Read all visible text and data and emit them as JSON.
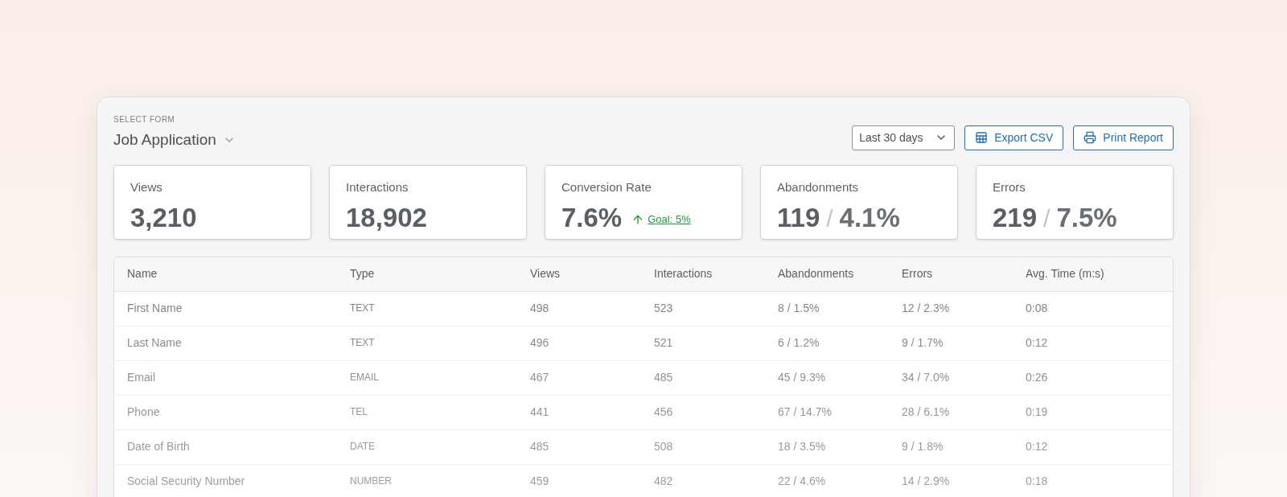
{
  "form_selector": {
    "label": "SELECT FORM",
    "value": "Job Application"
  },
  "date_range": {
    "value": "Last 30 days"
  },
  "buttons": [
    {
      "kind": "export",
      "label": "Export CSV"
    },
    {
      "kind": "print",
      "label": "Print Report"
    }
  ],
  "metrics": [
    {
      "label": "Views",
      "value": "3,210"
    },
    {
      "label": "Interactions",
      "value": "18,902"
    },
    {
      "label": "Conversion Rate",
      "value": "7.6%",
      "goal": "Goal: 5%"
    },
    {
      "label": "Abandonments",
      "value": "119",
      "separator": "/",
      "secondary": "4.1%"
    },
    {
      "label": "Errors",
      "value": "219",
      "separator": "/",
      "secondary": "7.5%"
    }
  ],
  "table": {
    "columns": [
      "Name",
      "Type",
      "Views",
      "Interactions",
      "Abandonments",
      "Errors",
      "Avg. Time (m:s)"
    ],
    "rows": [
      [
        "First Name",
        "TEXT",
        "498",
        "523",
        "8 / 1.5%",
        "12 / 2.3%",
        "0:08"
      ],
      [
        "Last Name",
        "TEXT",
        "496",
        "521",
        "6 / 1.2%",
        "9 / 1.7%",
        "0:12"
      ],
      [
        "Email",
        "EMAIL",
        "467",
        "485",
        "45 / 9.3%",
        "34 / 7.0%",
        "0:26"
      ],
      [
        "Phone",
        "TEL",
        "441",
        "456",
        "67 / 14.7%",
        "28 / 6.1%",
        "0:19"
      ],
      [
        "Date of Birth",
        "DATE",
        "485",
        "508",
        "18 / 3.5%",
        "9 / 1.8%",
        "0:12"
      ],
      [
        "Social Security Number",
        "NUMBER",
        "459",
        "482",
        "22 / 4.6%",
        "14 / 2.9%",
        "0:18"
      ]
    ]
  }
}
